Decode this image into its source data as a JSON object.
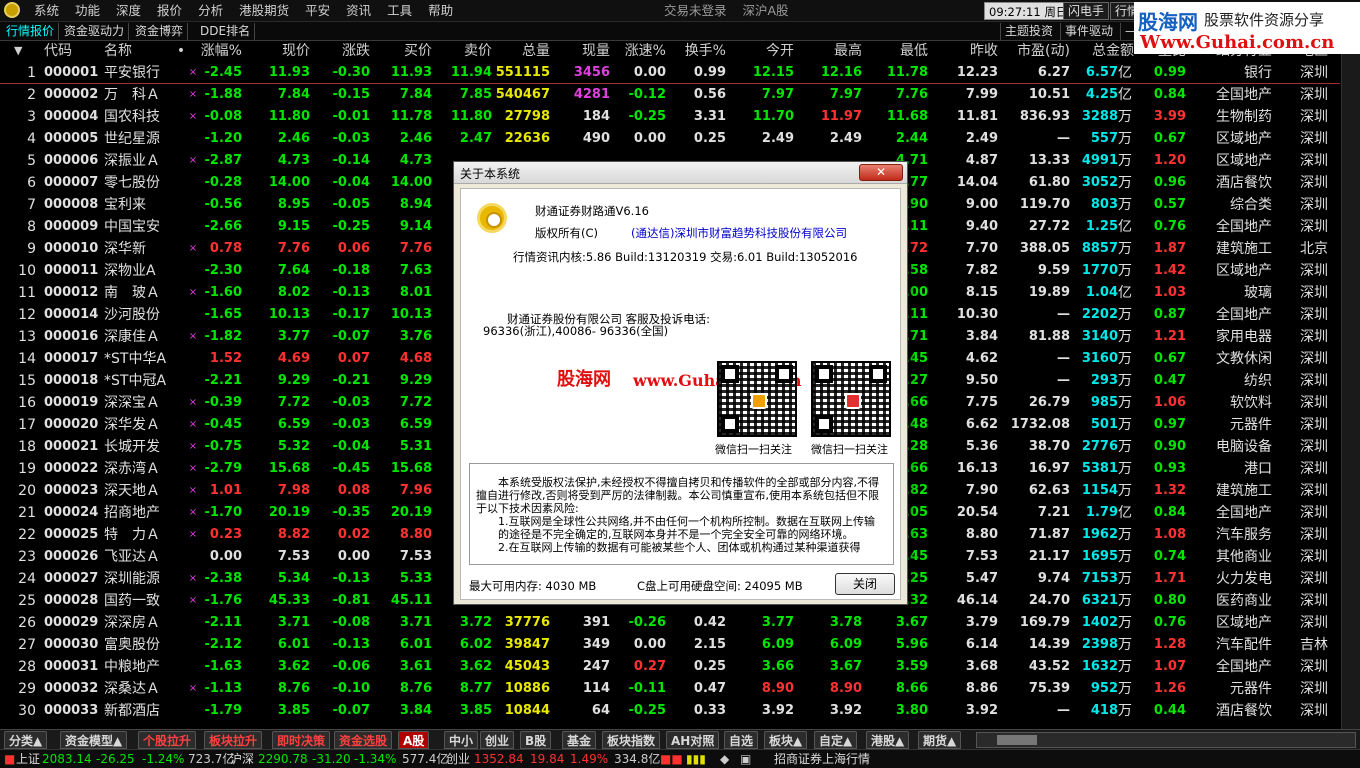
{
  "menubar": {
    "items": [
      "系统",
      "功能",
      "深度",
      "报价",
      "分析",
      "港股期货",
      "平安",
      "资讯",
      "工具",
      "帮助"
    ],
    "trade_status": "交易未登录",
    "market": "深沪A股",
    "clock": "09:27:11",
    "weekday": "周日",
    "flash_btn": "闪电手",
    "trade_btn": "行情"
  },
  "brand": {
    "name": "股海网",
    "slogan": "股票软件资源分享",
    "url": "Www.Guhai.com.cn"
  },
  "tabs": {
    "left": [
      "行情报价",
      "资金驱动力",
      "资金博弈",
      "DDE排名"
    ],
    "right": [
      "主题投资",
      "事件驱动",
      "—"
    ]
  },
  "columns": [
    "代码",
    "名称",
    "•",
    "涨幅%",
    "现价",
    "涨跌",
    "买价",
    "卖价",
    "总量",
    "现量",
    "涨速%",
    "换手%",
    "今开",
    "最高",
    "最低",
    "昨收",
    "市盈(动)",
    "总金额",
    "量比",
    "细分行业",
    "地区"
  ],
  "sort_indicator": "▼",
  "rows": [
    {
      "idx": "1",
      "code": "000001",
      "name": "平安银行",
      "m": "×",
      "chg": "-2.45",
      "price": "11.93",
      "diff": "-0.30",
      "bid": "11.93",
      "ask": "11.94",
      "vol": "551115",
      "cur": "3456",
      "spd": "0.00",
      "turn": "0.99",
      "open": "12.15",
      "high": "12.16",
      "low": "11.78",
      "prev": "12.23",
      "pe": "6.27",
      "amt": "6.57",
      "unit": "亿",
      "ratio": "0.99",
      "ind": "银行",
      "area": "深圳"
    },
    {
      "idx": "2",
      "code": "000002",
      "name": "万　科Ａ",
      "m": "×",
      "chg": "-1.88",
      "price": "7.84",
      "diff": "-0.15",
      "bid": "7.84",
      "ask": "7.85",
      "vol": "540467",
      "cur": "4281",
      "spd": "-0.12",
      "turn": "0.56",
      "open": "7.97",
      "high": "7.97",
      "low": "7.76",
      "prev": "7.99",
      "pe": "10.51",
      "amt": "4.25",
      "unit": "亿",
      "ratio": "0.84",
      "ind": "全国地产",
      "area": "深圳"
    },
    {
      "idx": "3",
      "code": "000004",
      "name": "国农科技",
      "m": "×",
      "chg": "-0.08",
      "price": "11.80",
      "diff": "-0.01",
      "bid": "11.78",
      "ask": "11.80",
      "vol": "27798",
      "cur": "184",
      "spd": "-0.25",
      "turn": "3.31",
      "open": "11.70",
      "high": "11.97",
      "low": "11.68",
      "prev": "11.81",
      "pe": "836.93",
      "amt": "3288",
      "unit": "万",
      "ratio": "3.99",
      "ind": "生物制药",
      "area": "深圳"
    },
    {
      "idx": "4",
      "code": "000005",
      "name": "世纪星源",
      "m": "",
      "chg": "-1.20",
      "price": "2.46",
      "diff": "-0.03",
      "bid": "2.46",
      "ask": "2.47",
      "vol": "22636",
      "cur": "490",
      "spd": "0.00",
      "turn": "0.25",
      "open": "2.49",
      "high": "2.49",
      "low": "2.44",
      "prev": "2.49",
      "pe": "—",
      "amt": "557",
      "unit": "万",
      "ratio": "0.67",
      "ind": "区域地产",
      "area": "深圳"
    },
    {
      "idx": "5",
      "code": "000006",
      "name": "深振业Ａ",
      "m": "×",
      "chg": "-2.87",
      "price": "4.73",
      "diff": "-0.14",
      "bid": "4.73",
      "ask": "",
      "vol": "",
      "cur": "",
      "spd": "",
      "turn": "",
      "open": "",
      "high": "",
      "low": "4.71",
      "prev": "4.87",
      "pe": "13.33",
      "amt": "4991",
      "unit": "万",
      "ratio": "1.20",
      "ind": "区域地产",
      "area": "深圳"
    },
    {
      "idx": "6",
      "code": "000007",
      "name": "零七股份",
      "m": "",
      "chg": "-0.28",
      "price": "14.00",
      "diff": "-0.04",
      "bid": "14.00",
      "ask": "",
      "vol": "",
      "cur": "",
      "spd": "",
      "turn": "",
      "open": "",
      "high": "",
      "low": "3.77",
      "prev": "14.04",
      "pe": "61.80",
      "amt": "3052",
      "unit": "万",
      "ratio": "0.96",
      "ind": "酒店餐饮",
      "area": "深圳"
    },
    {
      "idx": "7",
      "code": "000008",
      "name": "宝利来",
      "m": "",
      "chg": "-0.56",
      "price": "8.95",
      "diff": "-0.05",
      "bid": "8.94",
      "ask": "",
      "vol": "",
      "cur": "",
      "spd": "",
      "turn": "",
      "open": "",
      "high": "",
      "low": "3.90",
      "prev": "9.00",
      "pe": "119.70",
      "amt": "803",
      "unit": "万",
      "ratio": "0.57",
      "ind": "综合类",
      "area": "深圳"
    },
    {
      "idx": "8",
      "code": "000009",
      "name": "中国宝安",
      "m": "",
      "chg": "-2.66",
      "price": "9.15",
      "diff": "-0.25",
      "bid": "9.14",
      "ask": "",
      "vol": "",
      "cur": "",
      "spd": "",
      "turn": "",
      "open": "",
      "high": "",
      "low": "9.11",
      "prev": "9.40",
      "pe": "27.72",
      "amt": "1.25",
      "unit": "亿",
      "ratio": "0.76",
      "ind": "全国地产",
      "area": "深圳"
    },
    {
      "idx": "9",
      "code": "000010",
      "name": "深华新",
      "m": "×",
      "chg": "0.78",
      "price": "7.76",
      "diff": "0.06",
      "bid": "7.76",
      "ask": "",
      "vol": "",
      "cur": "",
      "spd": "",
      "turn": "",
      "open": "",
      "high": "",
      "low": "7.72",
      "prev": "7.70",
      "pe": "388.05",
      "amt": "8857",
      "unit": "万",
      "ratio": "1.87",
      "ind": "建筑施工",
      "area": "北京"
    },
    {
      "idx": "10",
      "code": "000011",
      "name": "深物业A",
      "m": "",
      "chg": "-2.30",
      "price": "7.64",
      "diff": "-0.18",
      "bid": "7.63",
      "ask": "",
      "vol": "",
      "cur": "",
      "spd": "",
      "turn": "",
      "open": "",
      "high": "",
      "low": "7.58",
      "prev": "7.82",
      "pe": "9.59",
      "amt": "1770",
      "unit": "万",
      "ratio": "1.42",
      "ind": "区域地产",
      "area": "深圳"
    },
    {
      "idx": "11",
      "code": "000012",
      "name": "南　玻Ａ",
      "m": "×",
      "chg": "-1.60",
      "price": "8.02",
      "diff": "-0.13",
      "bid": "8.01",
      "ask": "",
      "vol": "",
      "cur": "",
      "spd": "",
      "turn": "",
      "open": "",
      "high": "",
      "low": "8.00",
      "prev": "8.15",
      "pe": "19.89",
      "amt": "1.04",
      "unit": "亿",
      "ratio": "1.03",
      "ind": "玻璃",
      "area": "深圳"
    },
    {
      "idx": "12",
      "code": "000014",
      "name": "沙河股份",
      "m": "",
      "chg": "-1.65",
      "price": "10.13",
      "diff": "-0.17",
      "bid": "10.13",
      "ask": "",
      "vol": "",
      "cur": "",
      "spd": "",
      "turn": "",
      "open": "",
      "high": "",
      "low": "10.11",
      "prev": "10.30",
      "pe": "—",
      "amt": "2202",
      "unit": "万",
      "ratio": "0.87",
      "ind": "全国地产",
      "area": "深圳"
    },
    {
      "idx": "13",
      "code": "000016",
      "name": "深康佳Ａ",
      "m": "×",
      "chg": "-1.82",
      "price": "3.77",
      "diff": "-0.07",
      "bid": "3.76",
      "ask": "",
      "vol": "",
      "cur": "",
      "spd": "",
      "turn": "",
      "open": "",
      "high": "",
      "low": "3.71",
      "prev": "3.84",
      "pe": "81.88",
      "amt": "3140",
      "unit": "万",
      "ratio": "1.21",
      "ind": "家用电器",
      "area": "深圳"
    },
    {
      "idx": "14",
      "code": "000017",
      "name": "*ST中华A",
      "m": "",
      "chg": "1.52",
      "price": "4.69",
      "diff": "0.07",
      "bid": "4.68",
      "ask": "",
      "vol": "",
      "cur": "",
      "spd": "",
      "turn": "",
      "open": "",
      "high": "",
      "low": "4.45",
      "prev": "4.62",
      "pe": "—",
      "amt": "3160",
      "unit": "万",
      "ratio": "0.67",
      "ind": "文教休闲",
      "area": "深圳"
    },
    {
      "idx": "15",
      "code": "000018",
      "name": "*ST中冠A",
      "m": "",
      "chg": "-2.21",
      "price": "9.29",
      "diff": "-0.21",
      "bid": "9.29",
      "ask": "",
      "vol": "",
      "cur": "",
      "spd": "",
      "turn": "",
      "open": "",
      "high": "",
      "low": "9.27",
      "prev": "9.50",
      "pe": "—",
      "amt": "293",
      "unit": "万",
      "ratio": "0.47",
      "ind": "纺织",
      "area": "深圳"
    },
    {
      "idx": "16",
      "code": "000019",
      "name": "深深宝Ａ",
      "m": "×",
      "chg": "-0.39",
      "price": "7.72",
      "diff": "-0.03",
      "bid": "7.72",
      "ask": "",
      "vol": "",
      "cur": "",
      "spd": "",
      "turn": "",
      "open": "",
      "high": "",
      "low": "7.66",
      "prev": "7.75",
      "pe": "26.79",
      "amt": "985",
      "unit": "万",
      "ratio": "1.06",
      "ind": "软饮料",
      "area": "深圳"
    },
    {
      "idx": "17",
      "code": "000020",
      "name": "深华发Ａ",
      "m": "×",
      "chg": "-0.45",
      "price": "6.59",
      "diff": "-0.03",
      "bid": "6.59",
      "ask": "",
      "vol": "",
      "cur": "",
      "spd": "",
      "turn": "",
      "open": "",
      "high": "",
      "low": "6.48",
      "prev": "6.62",
      "pe": "1732.08",
      "amt": "501",
      "unit": "万",
      "ratio": "0.97",
      "ind": "元器件",
      "area": "深圳"
    },
    {
      "idx": "18",
      "code": "000021",
      "name": "长城开发",
      "m": "×",
      "chg": "-0.75",
      "price": "5.32",
      "diff": "-0.04",
      "bid": "5.31",
      "ask": "",
      "vol": "",
      "cur": "",
      "spd": "",
      "turn": "",
      "open": "",
      "high": "",
      "low": "5.28",
      "prev": "5.36",
      "pe": "38.70",
      "amt": "2776",
      "unit": "万",
      "ratio": "0.90",
      "ind": "电脑设备",
      "area": "深圳"
    },
    {
      "idx": "19",
      "code": "000022",
      "name": "深赤湾Ａ",
      "m": "×",
      "chg": "-2.79",
      "price": "15.68",
      "diff": "-0.45",
      "bid": "15.68",
      "ask": "",
      "vol": "",
      "cur": "",
      "spd": "",
      "turn": "",
      "open": "",
      "high": "",
      "low": "5.66",
      "prev": "16.13",
      "pe": "16.97",
      "amt": "5381",
      "unit": "万",
      "ratio": "0.93",
      "ind": "港口",
      "area": "深圳"
    },
    {
      "idx": "20",
      "code": "000023",
      "name": "深天地Ａ",
      "m": "×",
      "chg": "1.01",
      "price": "7.98",
      "diff": "0.08",
      "bid": "7.96",
      "ask": "",
      "vol": "",
      "cur": "",
      "spd": "",
      "turn": "",
      "open": "",
      "high": "",
      "low": "7.82",
      "prev": "7.90",
      "pe": "62.63",
      "amt": "1154",
      "unit": "万",
      "ratio": "1.32",
      "ind": "建筑施工",
      "area": "深圳"
    },
    {
      "idx": "21",
      "code": "000024",
      "name": "招商地产",
      "m": "×",
      "chg": "-1.70",
      "price": "20.19",
      "diff": "-0.35",
      "bid": "20.19",
      "ask": "",
      "vol": "",
      "cur": "",
      "spd": "",
      "turn": "",
      "open": "",
      "high": "",
      "low": "0.05",
      "prev": "20.54",
      "pe": "7.21",
      "amt": "1.79",
      "unit": "亿",
      "ratio": "0.84",
      "ind": "全国地产",
      "area": "深圳"
    },
    {
      "idx": "22",
      "code": "000025",
      "name": "特　力Ａ",
      "m": "×",
      "chg": "0.23",
      "price": "8.82",
      "diff": "0.02",
      "bid": "8.80",
      "ask": "",
      "vol": "",
      "cur": "",
      "spd": "",
      "turn": "",
      "open": "",
      "high": "",
      "low": "8.63",
      "prev": "8.80",
      "pe": "71.87",
      "amt": "1962",
      "unit": "万",
      "ratio": "1.08",
      "ind": "汽车服务",
      "area": "深圳"
    },
    {
      "idx": "23",
      "code": "000026",
      "name": "飞亚达Ａ",
      "m": "",
      "chg": "0.00",
      "price": "7.53",
      "diff": "0.00",
      "bid": "7.53",
      "ask": "",
      "vol": "",
      "cur": "",
      "spd": "",
      "turn": "",
      "open": "",
      "high": "",
      "low": "7.45",
      "prev": "7.53",
      "pe": "21.17",
      "amt": "1695",
      "unit": "万",
      "ratio": "0.74",
      "ind": "其他商业",
      "area": "深圳"
    },
    {
      "idx": "24",
      "code": "000027",
      "name": "深圳能源",
      "m": "×",
      "chg": "-2.38",
      "price": "5.34",
      "diff": "-0.13",
      "bid": "5.33",
      "ask": "",
      "vol": "",
      "cur": "",
      "spd": "",
      "turn": "",
      "open": "",
      "high": "",
      "low": "5.25",
      "prev": "5.47",
      "pe": "9.74",
      "amt": "7153",
      "unit": "万",
      "ratio": "1.71",
      "ind": "火力发电",
      "area": "深圳"
    },
    {
      "idx": "25",
      "code": "000028",
      "name": "国药一致",
      "m": "×",
      "chg": "-1.76",
      "price": "45.33",
      "diff": "-0.81",
      "bid": "45.11",
      "ask": "",
      "vol": "",
      "cur": "",
      "spd": "",
      "turn": "",
      "open": "",
      "high": "",
      "low": "4.32",
      "prev": "46.14",
      "pe": "24.70",
      "amt": "6321",
      "unit": "万",
      "ratio": "0.80",
      "ind": "医药商业",
      "area": "深圳"
    },
    {
      "idx": "26",
      "code": "000029",
      "name": "深深房Ａ",
      "m": "",
      "chg": "-2.11",
      "price": "3.71",
      "diff": "-0.08",
      "bid": "3.71",
      "ask": "3.72",
      "vol": "37776",
      "cur": "391",
      "spd": "-0.26",
      "turn": "0.42",
      "open": "3.77",
      "high": "3.78",
      "low": "3.67",
      "prev": "3.79",
      "pe": "169.79",
      "amt": "1402",
      "unit": "万",
      "ratio": "0.76",
      "ind": "区域地产",
      "area": "深圳"
    },
    {
      "idx": "27",
      "code": "000030",
      "name": "富奥股份",
      "m": "",
      "chg": "-2.12",
      "price": "6.01",
      "diff": "-0.13",
      "bid": "6.01",
      "ask": "6.02",
      "vol": "39847",
      "cur": "349",
      "spd": "0.00",
      "turn": "2.15",
      "open": "6.09",
      "high": "6.09",
      "low": "5.96",
      "prev": "6.14",
      "pe": "14.39",
      "amt": "2398",
      "unit": "万",
      "ratio": "1.28",
      "ind": "汽车配件",
      "area": "吉林"
    },
    {
      "idx": "28",
      "code": "000031",
      "name": "中粮地产",
      "m": "",
      "chg": "-1.63",
      "price": "3.62",
      "diff": "-0.06",
      "bid": "3.61",
      "ask": "3.62",
      "vol": "45043",
      "cur": "247",
      "spd": "0.27",
      "turn": "0.25",
      "open": "3.66",
      "high": "3.67",
      "low": "3.59",
      "prev": "3.68",
      "pe": "43.52",
      "amt": "1632",
      "unit": "万",
      "ratio": "1.07",
      "ind": "全国地产",
      "area": "深圳"
    },
    {
      "idx": "29",
      "code": "000032",
      "name": "深桑达Ａ",
      "m": "×",
      "chg": "-1.13",
      "price": "8.76",
      "diff": "-0.10",
      "bid": "8.76",
      "ask": "8.77",
      "vol": "10886",
      "cur": "114",
      "spd": "-0.11",
      "turn": "0.47",
      "open": "8.90",
      "high": "8.90",
      "low": "8.66",
      "prev": "8.86",
      "pe": "75.39",
      "amt": "952",
      "unit": "万",
      "ratio": "1.26",
      "ind": "元器件",
      "area": "深圳"
    },
    {
      "idx": "30",
      "code": "000033",
      "name": "新都酒店",
      "m": "",
      "chg": "-1.79",
      "price": "3.85",
      "diff": "-0.07",
      "bid": "3.84",
      "ask": "3.85",
      "vol": "10844",
      "cur": "64",
      "spd": "-0.25",
      "turn": "0.33",
      "open": "3.92",
      "high": "3.92",
      "low": "3.80",
      "prev": "3.92",
      "pe": "—",
      "amt": "418",
      "unit": "万",
      "ratio": "0.44",
      "ind": "酒店餐饮",
      "area": "深圳"
    }
  ],
  "bottom_tabs": [
    "分类▲",
    "资金模型▲",
    "个股拉升",
    "板块拉升",
    "即时决策",
    "资金选股",
    "A股",
    "中小",
    "创业",
    "B股",
    "基金",
    "板块指数",
    "AH对照",
    "自选",
    "板块▲",
    "自定▲",
    "港股▲",
    "期货▲"
  ],
  "status": {
    "sh_label": "上证",
    "sh_idx": "2083.14",
    "sh_chg": "-26.25",
    "sh_pct": "-1.24%",
    "sh_amt": "723.7亿",
    "hs_label": "沪深",
    "hs_idx": "2290.78",
    "hs_chg": "-31.20",
    "hs_pct": "-1.34%",
    "hs_amt": "577.4亿",
    "cy_label": "创业",
    "cy_idx": "1352.84",
    "cy_chg": "19.84",
    "cy_pct": "1.49%",
    "cy_amt": "334.8亿",
    "server": "招商证券上海行情"
  },
  "dialog": {
    "title": "关于本系统",
    "close_x": "✕",
    "product": "财通证券财路通V6.16",
    "copyright_label": "版权所有(C)",
    "copyright_owner": "(通达信)深圳市财富趋势科技股份有限公司",
    "build_info": "行情资讯内核:5.86 Build:13120319 交易:6.01 Build:13052016",
    "company_line": "财通证券股份有限公司 客服及投诉电话:",
    "phones": "96336(浙江),40086- 96336(全国)",
    "watermark_name": "股海网",
    "watermark_url": "www.Guhai.com.cn",
    "qr1_caption": "微信扫一扫关注",
    "qr2_caption": "微信扫一扫关注",
    "legal_p1": "本系统受版权法保护,未经授权不得擅自拷贝和传播软件的全部或部分内容,不得擅自进行修改,否则将受到严厉的法律制裁。本公司慎重宣布,使用本系统包括但不限于以下技术因素风险:",
    "legal_p2": "1.互联网是全球性公共网络,并不由任何一个机构所控制。数据在互联网上传输的途径是不完全确定的,互联网本身并不是一个完全安全可靠的网络环境。",
    "legal_p3": "2.在互联网上传输的数据有可能被某些个人、团体或机构通过某种渠道获得",
    "mem_label": "最大可用内存: 4030 MB",
    "disk_label": "C盘上可用硬盘空间: 24095 MB",
    "close_btn": "关闭"
  }
}
